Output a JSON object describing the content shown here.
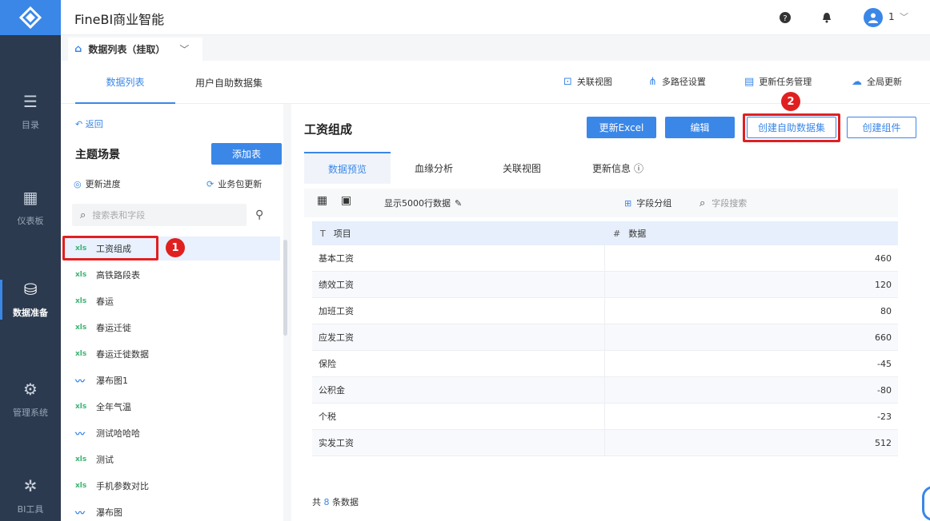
{
  "app": {
    "title": "FineBI商业智能",
    "user": "1"
  },
  "tabbar": {
    "active_tab": "数据列表（挂取）"
  },
  "sidebar": {
    "items": [
      {
        "label": "目录",
        "icon": "list-icon"
      },
      {
        "label": "仪表板",
        "icon": "dashboard-icon"
      },
      {
        "label": "数据准备",
        "icon": "database-icon"
      },
      {
        "label": "管理系统",
        "icon": "gear-icon"
      },
      {
        "label": "BI工具",
        "icon": "tools-icon"
      }
    ]
  },
  "subheader": {
    "tabs": [
      "数据列表",
      "用户自助数据集"
    ],
    "tools": [
      "关联视图",
      "多路径设置",
      "更新任务管理",
      "全局更新"
    ]
  },
  "left_panel": {
    "back": "返回",
    "title": "主题场景",
    "add_button": "添加表",
    "update_progress": "更新进度",
    "package_update": "业务包更新",
    "search_placeholder": "搜索表和字段",
    "tables": [
      {
        "name": "工资组成",
        "type": "xls"
      },
      {
        "name": "高铁路段表",
        "type": "xls"
      },
      {
        "name": "春运",
        "type": "xls"
      },
      {
        "name": "春运迁徙",
        "type": "xls"
      },
      {
        "name": "春运迁徙数据",
        "type": "xls"
      },
      {
        "name": "瀑布图1",
        "type": "line"
      },
      {
        "name": "全年气温",
        "type": "xls"
      },
      {
        "name": "测试哈哈哈",
        "type": "line"
      },
      {
        "name": "测试",
        "type": "xls"
      },
      {
        "name": "手机参数对比",
        "type": "xls"
      },
      {
        "name": "瀑布图",
        "type": "line"
      }
    ]
  },
  "main": {
    "title": "工资组成",
    "buttons": [
      "更新Excel",
      "编辑",
      "创建自助数据集",
      "创建组件"
    ],
    "content_tabs": [
      "数据预览",
      "血缘分析",
      "关联视图",
      "更新信息"
    ],
    "toolbar": {
      "show_rows": "显示5000行数据",
      "field_group": "字段分组",
      "field_search": "字段搜索"
    },
    "columns": [
      "项目",
      "数据"
    ],
    "rows": [
      [
        "基本工资",
        "460"
      ],
      [
        "绩效工资",
        "120"
      ],
      [
        "加班工资",
        "80"
      ],
      [
        "应发工资",
        "660"
      ],
      [
        "保险",
        "-45"
      ],
      [
        "公积金",
        "-80"
      ],
      [
        "个税",
        "-23"
      ],
      [
        "实发工资",
        "512"
      ]
    ],
    "footer_prefix": "共",
    "footer_count": "8",
    "footer_suffix": "条数据"
  },
  "annotations": {
    "badge1": "1",
    "badge2": "2"
  },
  "colors": {
    "accent": "#3a87e8",
    "nav_bg": "#2b3a4f",
    "highlight": "#e02020"
  }
}
